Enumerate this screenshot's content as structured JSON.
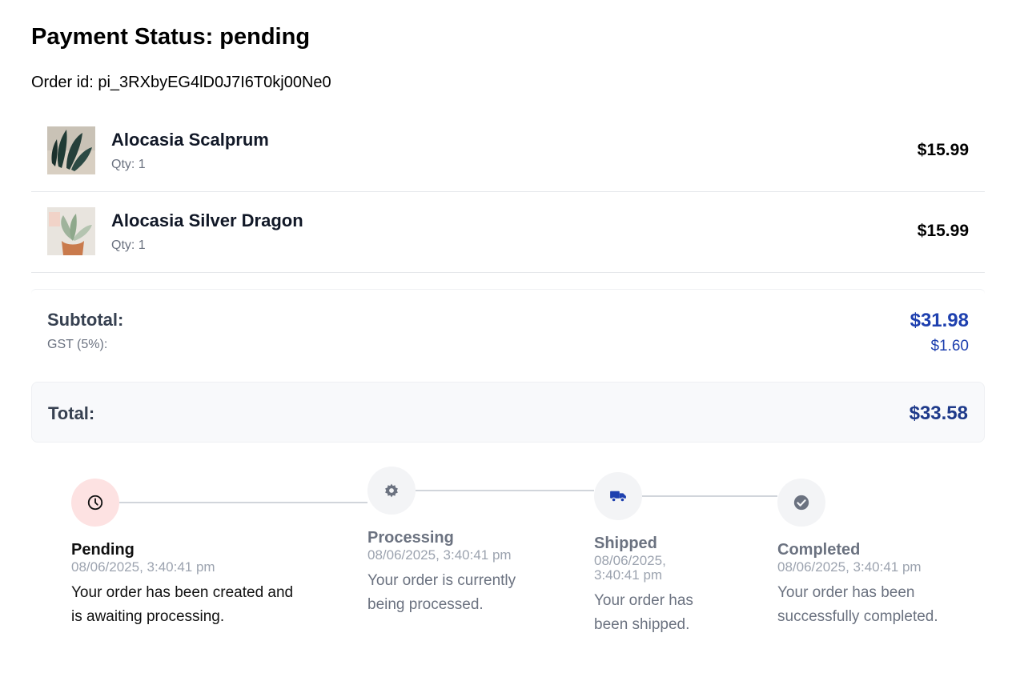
{
  "page": {
    "title": "Payment Status: pending",
    "order_id_label": "Order id: pi_3RXbyEG4lD0J7I6T0kj00Ne0"
  },
  "items": [
    {
      "name": "Alocasia Scalprum",
      "qty": "Qty: 1",
      "price": "$15.99"
    },
    {
      "name": "Alocasia Silver Dragon",
      "qty": "Qty: 1",
      "price": "$15.99"
    }
  ],
  "summary": {
    "subtotal_label": "Subtotal:",
    "subtotal_value": "$31.98",
    "gst_label": "GST (5%):",
    "gst_value": "$1.60",
    "total_label": "Total:",
    "total_value": "$33.58"
  },
  "timeline": {
    "steps": [
      {
        "title": "Pending",
        "date": "08/06/2025, 3:40:41 pm",
        "description": "Your order has been created and is awaiting processing.",
        "icon": "clock-icon",
        "state": "active"
      },
      {
        "title": "Processing",
        "date": "08/06/2025, 3:40:41 pm",
        "description": "Your order is currently being processed.",
        "icon": "gear-icon",
        "state": "inactive"
      },
      {
        "title": "Shipped",
        "date": "08/06/2025, 3:40:41 pm",
        "description": "Your order has been shipped.",
        "icon": "truck-icon",
        "state": "inactive"
      },
      {
        "title": "Completed",
        "date": "08/06/2025, 3:40:41 pm",
        "description": "Your order has been successfully completed.",
        "icon": "check-circle-icon",
        "state": "inactive"
      }
    ]
  },
  "colors": {
    "accent_blue": "#1e40af",
    "pending_bg": "#fde2e2",
    "inactive_circle": "#f3f4f6"
  }
}
